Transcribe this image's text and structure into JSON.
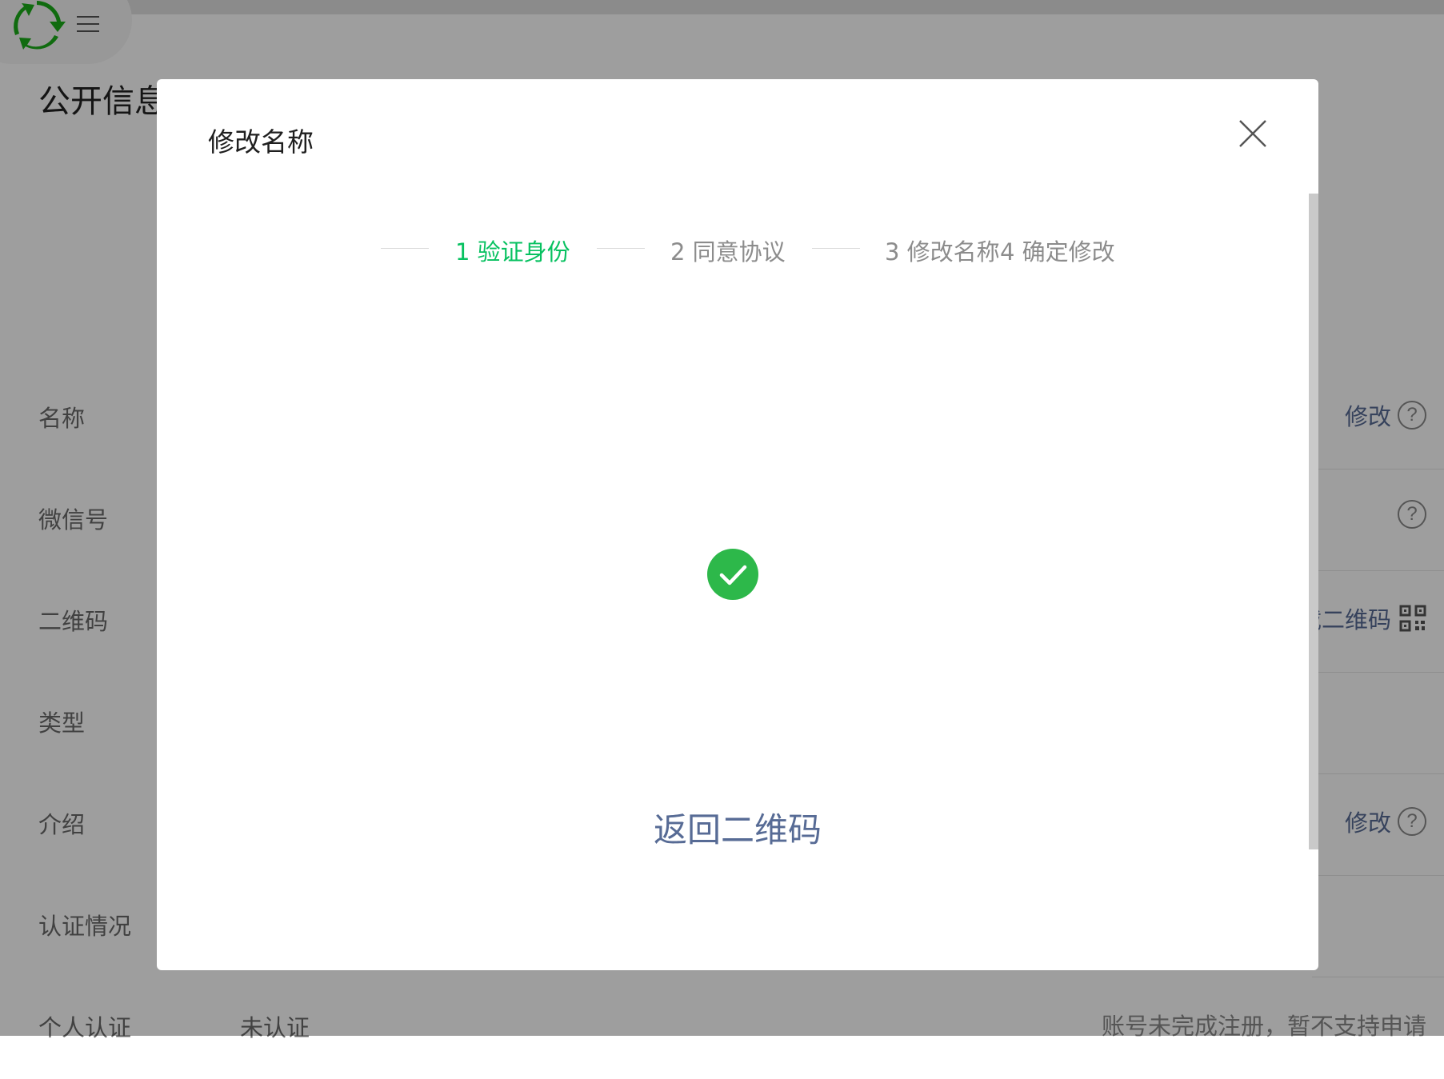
{
  "page": {
    "title": "公开信息",
    "rows": [
      {
        "label": "名称",
        "value": "",
        "action": "修改",
        "note": ""
      },
      {
        "label": "微信号",
        "value": "",
        "action": "",
        "note": ""
      },
      {
        "label": "二维码",
        "value": "",
        "action": "载二维码",
        "note": ""
      },
      {
        "label": "类型",
        "value": "",
        "action": "",
        "note": ""
      },
      {
        "label": "介绍",
        "value": "",
        "action": "修改",
        "note": ""
      },
      {
        "label": "认证情况",
        "value": "",
        "action": "",
        "note": ""
      },
      {
        "label": "个人认证",
        "value": "未认证",
        "action": "",
        "note": "账号未完成注册，暂不支持申请"
      }
    ]
  },
  "dialog": {
    "title": "修改名称",
    "steps": [
      {
        "label": "1 验证身份",
        "state": "active"
      },
      {
        "label": "2 同意协议",
        "state": "pending"
      },
      {
        "label": "3 修改名称",
        "state": "pending"
      },
      {
        "label": "4 确定修改",
        "state": "pending"
      }
    ],
    "status_icon": "success-check-icon",
    "return_label": "返回二维码"
  },
  "colors": {
    "brand_green": "#07c160",
    "link_blue": "#576b95",
    "success_green": "#2db84a"
  },
  "icons": {
    "logo": "app-logo-icon",
    "menu": "hamburger-menu-icon",
    "close": "close-icon",
    "help": "help-circle-icon",
    "qr": "qr-code-icon"
  }
}
